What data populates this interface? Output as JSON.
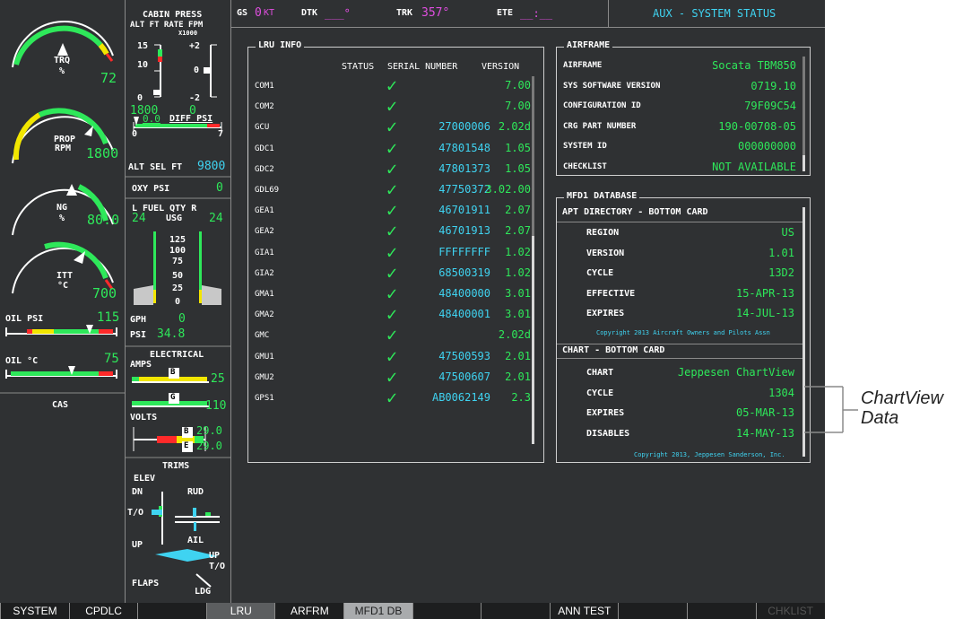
{
  "topbar": {
    "gs_label": "GS",
    "gs_value": "0",
    "gs_unit": "KT",
    "dtk_label": "DTK",
    "dtk_value": "___°",
    "trk_label": "TRK",
    "trk_value": "357°",
    "ete_label": "ETE",
    "ete_value": "__:__",
    "page_title": "AUX - SYSTEM STATUS"
  },
  "gauges": {
    "trq": {
      "label": "TRQ",
      "unit": "%",
      "value": "72"
    },
    "prop": {
      "label": "PROP",
      "unit": "RPM",
      "value": "1800"
    },
    "ng": {
      "label": "NG",
      "unit": "%",
      "value": "80.0"
    },
    "itt": {
      "label": "ITT",
      "unit": "°C",
      "value": "700"
    },
    "oil_psi": {
      "label": "OIL PSI",
      "value": "115"
    },
    "oil_c": {
      "label": "OIL °C",
      "value": "75"
    },
    "cas": "CAS"
  },
  "cabin": {
    "title": "CABIN PRESS",
    "sub": "ALT FT RATE FPM",
    "x1000": "X1000",
    "t15": "15",
    "t10": "10",
    "t0": "0",
    "tp2": "+2",
    "tr0": "0",
    "tm2": "-2",
    "alt": "1800",
    "rate": "0",
    "diff_value": "0.0",
    "diff_label": "DIFF PSI",
    "d0": "0",
    "d7": "7",
    "altsel_label": "ALT SEL FT",
    "altsel_value": "9800",
    "oxy_label": "OXY PSI",
    "oxy_value": "0"
  },
  "fuel": {
    "title": "L FUEL QTY R",
    "unit": "USG",
    "left": "24",
    "right": "24",
    "scale": [
      "125",
      "100",
      "75",
      "50",
      "25",
      "0"
    ],
    "gph_label": "GPH",
    "gph_value": "0",
    "psi_label": "PSI",
    "psi_value": "34.8"
  },
  "electrical": {
    "title": "ELECTRICAL",
    "amps": "AMPS",
    "amps_b": "25",
    "amps_g": "110",
    "volts": "VOLTS",
    "volts_b": "29.0",
    "volts_e": "29.0",
    "b": "B",
    "g": "G",
    "e": "E"
  },
  "trims": {
    "title": "TRIMS",
    "elev": "ELEV",
    "dn": "DN",
    "to": "T/O",
    "up": "UP",
    "rud": "RUD",
    "ail": "AIL",
    "up2": "UP",
    "to2": "T/O",
    "flaps": "FLAPS",
    "ldg": "LDG"
  },
  "lru": {
    "title": "LRU INFO",
    "headers": {
      "status": "STATUS",
      "serial": "SERIAL NUMBER",
      "version": "VERSION"
    },
    "rows": [
      {
        "name": "COM1",
        "serial": "",
        "version": "7.00"
      },
      {
        "name": "COM2",
        "serial": "",
        "version": "7.00"
      },
      {
        "name": "GCU",
        "serial": "27000006",
        "version": "2.02d"
      },
      {
        "name": "GDC1",
        "serial": "47801548",
        "version": "1.05"
      },
      {
        "name": "GDC2",
        "serial": "47801373",
        "version": "1.05"
      },
      {
        "name": "GDL69",
        "serial": "47750372",
        "version": "3.02.00"
      },
      {
        "name": "GEA1",
        "serial": "46701911",
        "version": "2.07"
      },
      {
        "name": "GEA2",
        "serial": "46701913",
        "version": "2.07"
      },
      {
        "name": "GIA1",
        "serial": "FFFFFFFF",
        "version": "1.02"
      },
      {
        "name": "GIA2",
        "serial": "68500319",
        "version": "1.02"
      },
      {
        "name": "GMA1",
        "serial": "48400000",
        "version": "3.01"
      },
      {
        "name": "GMA2",
        "serial": "48400001",
        "version": "3.01"
      },
      {
        "name": "GMC",
        "serial": "",
        "version": "2.02d"
      },
      {
        "name": "GMU1",
        "serial": "47500593",
        "version": "2.01"
      },
      {
        "name": "GMU2",
        "serial": "47500607",
        "version": "2.01"
      },
      {
        "name": "GPS1",
        "serial": "AB0062149",
        "version": "2.3"
      }
    ],
    "check": "✓"
  },
  "airframe": {
    "title": "AIRFRAME",
    "rows": [
      {
        "label": "AIRFRAME",
        "value": "Socata TBM850"
      },
      {
        "label": "SYS SOFTWARE VERSION",
        "value": "0719.10"
      },
      {
        "label": "CONFIGURATION ID",
        "value": "79F09C54"
      },
      {
        "label": "CRG PART NUMBER",
        "value": "190-00708-05"
      },
      {
        "label": "SYSTEM ID",
        "value": "000000000"
      },
      {
        "label": "CHECKLIST",
        "value": "NOT AVAILABLE"
      }
    ]
  },
  "mfd_db": {
    "title": "MFD1 DATABASE",
    "apt_header": "APT DIRECTORY - BOTTOM CARD",
    "apt_rows": [
      {
        "label": "REGION",
        "value": "US"
      },
      {
        "label": "VERSION",
        "value": "1.01"
      },
      {
        "label": "CYCLE",
        "value": "13D2"
      },
      {
        "label": "EFFECTIVE",
        "value": "15-APR-13"
      },
      {
        "label": "EXPIRES",
        "value": "14-JUL-13"
      }
    ],
    "apt_copyright": "Copyright 2013 Aircraft Owners and Pilots Assn",
    "chart_header": "CHART - BOTTOM CARD",
    "chart_rows": [
      {
        "label": "CHART",
        "value": "Jeppesen ChartView"
      },
      {
        "label": "CYCLE",
        "value": "1304"
      },
      {
        "label": "EXPIRES",
        "value": "05-MAR-13"
      },
      {
        "label": "DISABLES",
        "value": "14-MAY-13"
      }
    ],
    "chart_copyright": "Copyright 2013, Jeppesen Sanderson, Inc."
  },
  "softkeys": [
    "SYSTEM",
    "CPDLC",
    "",
    "LRU",
    "ARFRM",
    "MFD1 DB",
    "",
    "",
    "ANN TEST",
    "",
    "",
    "CHKLIST"
  ],
  "callout": {
    "line1": "ChartView",
    "line2": "Data"
  },
  "colors": {
    "green": "#2ee85a",
    "cyan": "#3fd3f1",
    "magenta": "#e04ee0",
    "bg": "#2f3133",
    "yellow": "#f2e600",
    "red": "#ff2a2a"
  }
}
